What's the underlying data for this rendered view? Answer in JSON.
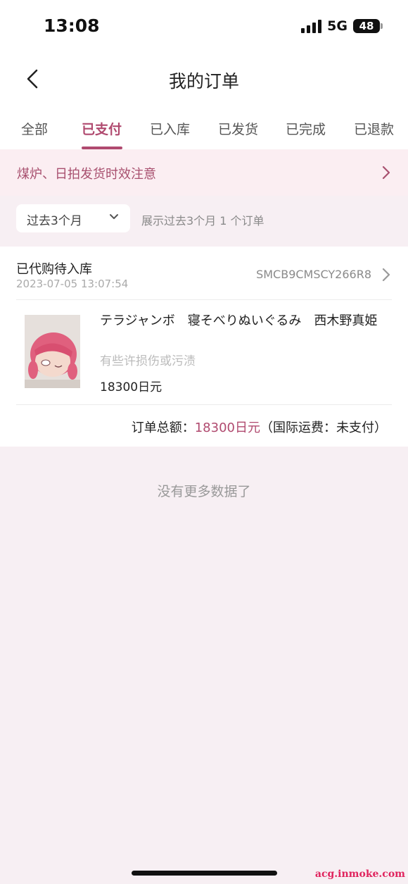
{
  "status_bar": {
    "time": "13:08",
    "network": "5G",
    "battery": "48"
  },
  "header": {
    "title": "我的订单"
  },
  "tabs": [
    {
      "label": "全部",
      "active": false
    },
    {
      "label": "已支付",
      "active": true
    },
    {
      "label": "已入库",
      "active": false
    },
    {
      "label": "已发货",
      "active": false
    },
    {
      "label": "已完成",
      "active": false
    },
    {
      "label": "已退款",
      "active": false
    }
  ],
  "notice": {
    "text": "煤炉、日拍发货时效注意"
  },
  "filter": {
    "period": "过去3个月",
    "summary": "展示过去3个月 1 个订单"
  },
  "order": {
    "status": "已代购待入库",
    "date": "2023-07-05 13:07:54",
    "id": "SMCB9CMSCY266R8",
    "item": {
      "name": "テラジャンボ　寝そべりぬいぐるみ　西木野真姫",
      "condition": "有些许损伤或污渍",
      "price": "18300日元"
    },
    "total_label": "订单总额：",
    "total_amount": "18300日元",
    "shipping_note": "（国际运费：未支付）"
  },
  "footer": {
    "no_more": "没有更多数据了"
  },
  "watermark": "acg.inmoke.com",
  "colors": {
    "accent": "#b04a6f",
    "notice_bg": "#fbeef2",
    "page_bg": "#f7eff3"
  }
}
